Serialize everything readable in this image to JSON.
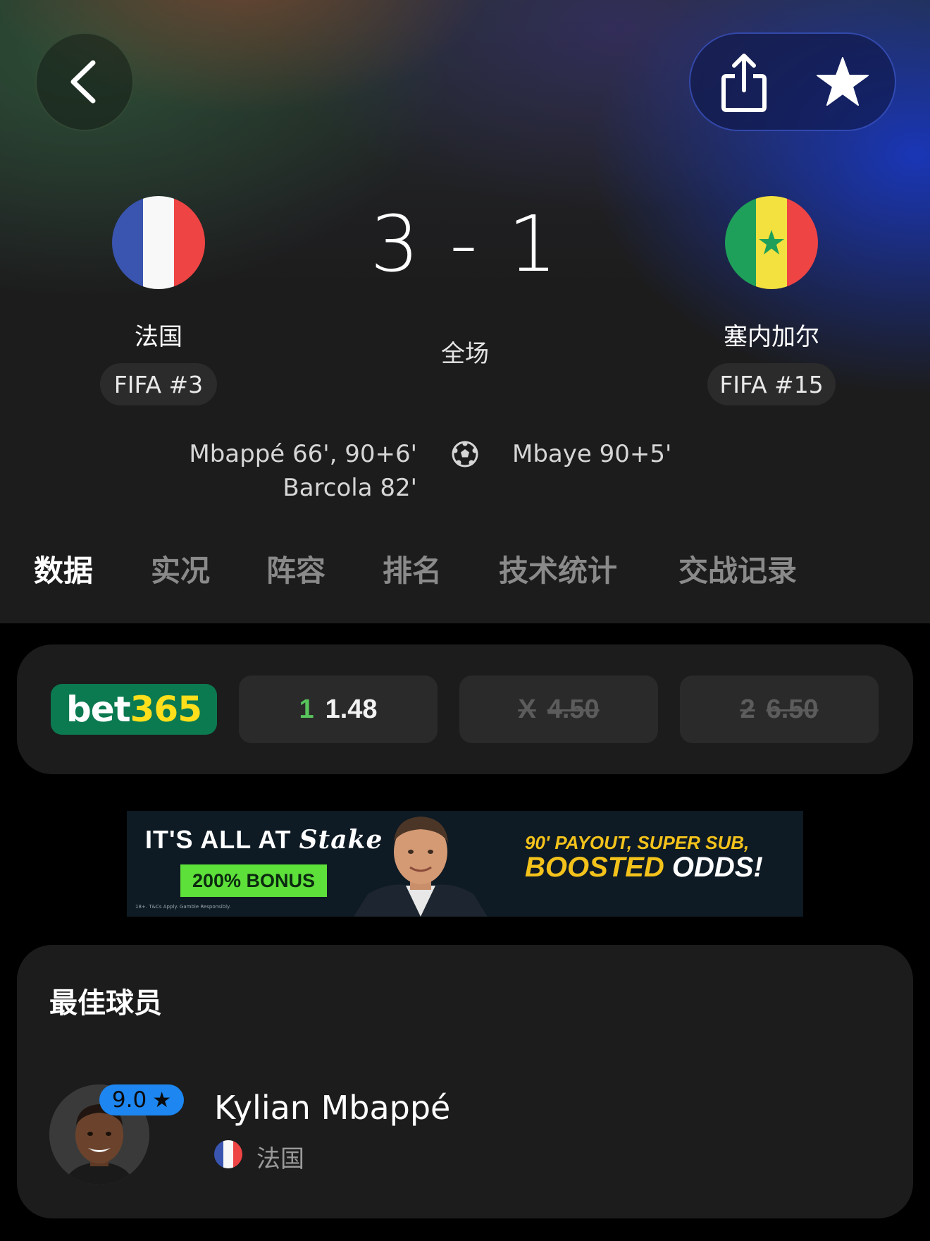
{
  "match": {
    "home": {
      "name": "法国",
      "rank": "FIFA #3",
      "flag_colors": [
        "#3a55b0",
        "#f8f8f8",
        "#ef4444"
      ]
    },
    "away": {
      "name": "塞内加尔",
      "rank": "FIFA #15",
      "flag_colors": [
        "#1fa05a",
        "#f2e13f",
        "#ef4444"
      ]
    },
    "score": "3 - 1",
    "status": "全场",
    "home_scorers": [
      "Mbappé 66', 90+6'",
      "Barcola 82'"
    ],
    "away_scorers": [
      "Mbaye 90+5'"
    ]
  },
  "tabs": [
    {
      "label": "数据",
      "active": true
    },
    {
      "label": "实况",
      "active": false
    },
    {
      "label": "阵容",
      "active": false
    },
    {
      "label": "排名",
      "active": false
    },
    {
      "label": "技术统计",
      "active": false
    },
    {
      "label": "交战记录",
      "active": false
    }
  ],
  "odds": {
    "bookmaker": {
      "part1": "bet",
      "part2": "365"
    },
    "home": {
      "label": "1",
      "value": "1.48",
      "available": true
    },
    "draw": {
      "label": "X",
      "value": "4.50",
      "available": false
    },
    "away": {
      "label": "2",
      "value": "6.50",
      "available": false
    }
  },
  "ad": {
    "headline": "IT'S ALL AT",
    "brand": "Stake",
    "bonus": "200% BONUS",
    "fine_print": "18+. T&Cs Apply. Gamble Responsibly.",
    "line1": "90' PAYOUT, SUPER SUB,",
    "line2_a": "BOOSTED",
    "line2_b": "ODDS!"
  },
  "best_player": {
    "section_title": "最佳球员",
    "name": "Kylian Mbappé",
    "rating": "9.0",
    "team": "法国"
  },
  "icons": {
    "back": "chevron-left-icon",
    "share": "share-icon",
    "favorite": "star-icon",
    "goal": "soccer-ball-icon"
  },
  "colors": {
    "accent_blue": "#1d86f0",
    "odds_green": "#58c45c",
    "bet365_green": "#0b7a50",
    "bet365_yellow": "#ffdf1b"
  }
}
